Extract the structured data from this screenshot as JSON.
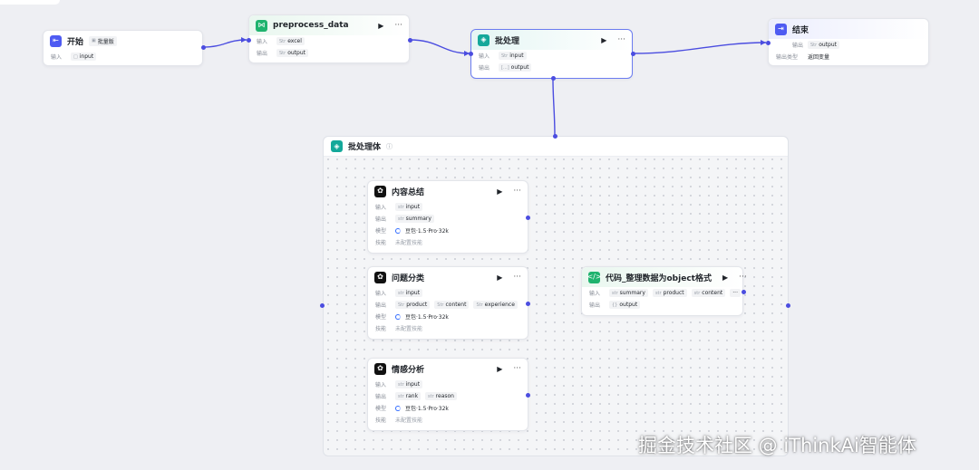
{
  "colors": {
    "edge": "#4b4de0",
    "start_icon": "#4e5bf2",
    "end_icon": "#4e5bf2",
    "data_icon": "#1fb36e",
    "batch_icon": "#14a89a",
    "code_icon": "#1fb36e",
    "llm_icon": "#111111"
  },
  "nodes": {
    "start": {
      "title": "开始",
      "icon": "start-icon",
      "badge": "批量版",
      "rows": [
        {
          "key": "输入",
          "tags": [
            {
              "type": "□",
              "name": "input"
            }
          ]
        }
      ]
    },
    "preprocess": {
      "title": "preprocess_data",
      "icon": "workflow-icon",
      "rows": [
        {
          "key": "输入",
          "tags": [
            {
              "type": "Str",
              "name": "excel"
            }
          ]
        },
        {
          "key": "输出",
          "tags": [
            {
              "type": "Str",
              "name": "output"
            }
          ]
        }
      ]
    },
    "batch": {
      "title": "批处理",
      "icon": "batch-icon",
      "rows": [
        {
          "key": "输入",
          "tags": [
            {
              "type": "Str",
              "name": "input"
            }
          ]
        },
        {
          "key": "输出",
          "tags": [
            {
              "type": "[...]",
              "name": "output"
            }
          ]
        }
      ]
    },
    "end": {
      "title": "结束",
      "icon": "end-icon",
      "rows": [
        {
          "key": "输出",
          "tags": [
            {
              "type": "Str",
              "name": "output"
            }
          ]
        },
        {
          "key": "输出类型",
          "text": "返回变量"
        }
      ]
    },
    "batch_body": {
      "title": "批处理体"
    },
    "summary": {
      "title": "内容总结",
      "rows": [
        {
          "key": "输入",
          "tags": [
            {
              "type": "str",
              "name": "input"
            }
          ]
        },
        {
          "key": "输出",
          "tags": [
            {
              "type": "str",
              "name": "summary"
            }
          ]
        },
        {
          "key": "模型",
          "model": "豆包·1.5·Pro·32k"
        },
        {
          "key": "技能",
          "text": "未配置技能"
        }
      ]
    },
    "classify": {
      "title": "问题分类",
      "rows": [
        {
          "key": "输入",
          "tags": [
            {
              "type": "str",
              "name": "input"
            }
          ]
        },
        {
          "key": "输出",
          "tags": [
            {
              "type": "Str",
              "name": "product"
            },
            {
              "type": "Str",
              "name": "content"
            },
            {
              "type": "Str",
              "name": "experience"
            }
          ]
        },
        {
          "key": "模型",
          "model": "豆包·1.5·Pro·32k"
        },
        {
          "key": "技能",
          "text": "未配置技能"
        }
      ]
    },
    "sentiment": {
      "title": "情感分析",
      "rows": [
        {
          "key": "输入",
          "tags": [
            {
              "type": "str",
              "name": "input"
            }
          ]
        },
        {
          "key": "输出",
          "tags": [
            {
              "type": "str",
              "name": "rank"
            },
            {
              "type": "str",
              "name": "reason"
            }
          ]
        },
        {
          "key": "模型",
          "model": "豆包·1.5·Pro·32k"
        },
        {
          "key": "技能",
          "text": "未配置技能"
        }
      ]
    },
    "code": {
      "title": "代码_整理数据为object格式",
      "rows": [
        {
          "key": "输入",
          "tags": [
            {
              "type": "str",
              "name": "summary"
            },
            {
              "type": "str",
              "name": "product"
            },
            {
              "type": "str",
              "name": "content"
            }
          ]
        },
        {
          "key": "输出",
          "tags": [
            {
              "type": "{}",
              "name": "output"
            }
          ]
        }
      ]
    }
  },
  "watermark": "掘金技术社区 @ iThinkAi智能体"
}
